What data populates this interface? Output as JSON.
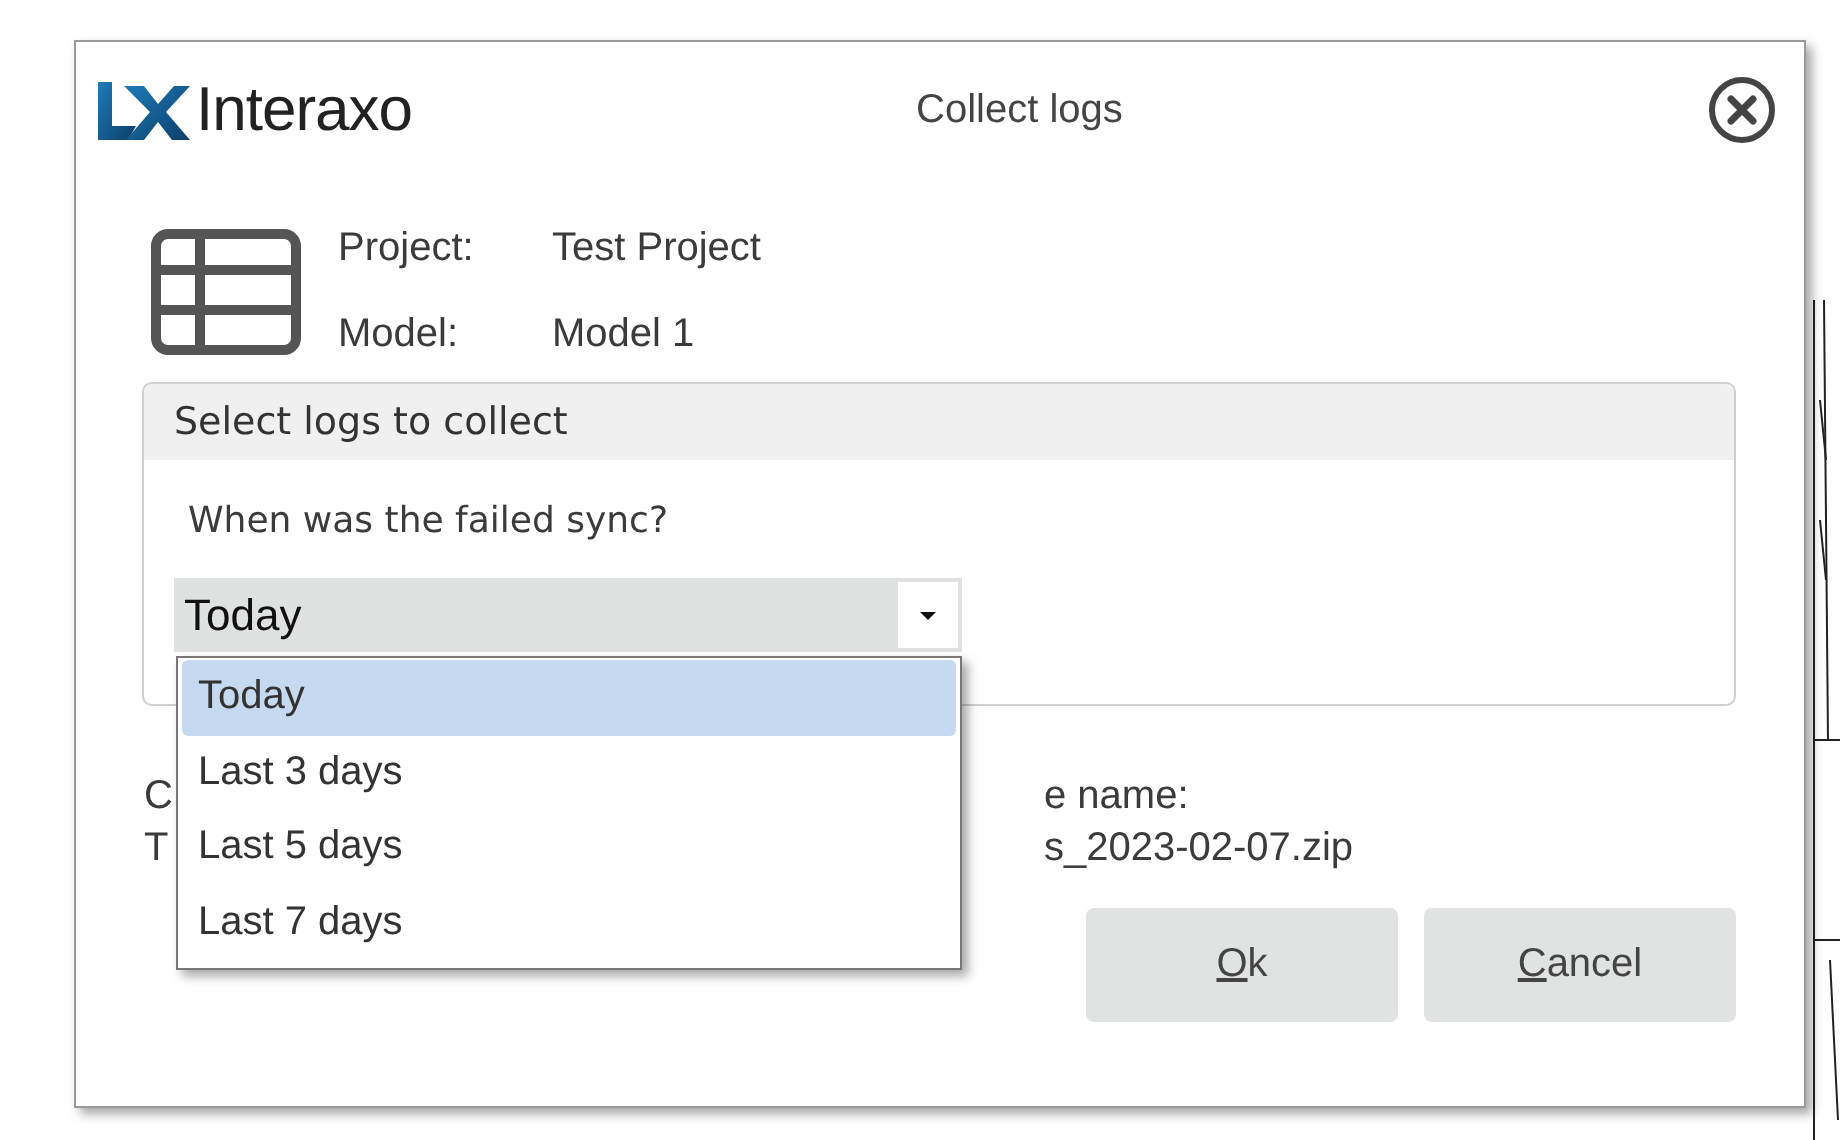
{
  "logo": {
    "text": "Interaxo"
  },
  "title": "Collect logs",
  "info": [
    {
      "label": "Project:",
      "value": "Test Project"
    },
    {
      "label": "Model:",
      "value": "Model 1"
    }
  ],
  "group": {
    "title": "Select logs to collect",
    "question": "When was the failed sync?",
    "select": {
      "value": "Today",
      "expanded": true,
      "options": [
        {
          "label": "Today",
          "selected": true
        },
        {
          "label": "Last 3 days",
          "selected": false
        },
        {
          "label": "Last 5 days",
          "selected": false
        },
        {
          "label": "Last 7 days",
          "selected": false
        }
      ]
    }
  },
  "output": {
    "left": [
      "C",
      "T"
    ],
    "right": [
      "e name:",
      "s_2023-02-07.zip"
    ]
  },
  "buttons": [
    {
      "label": "Ok",
      "underline_first": true
    },
    {
      "label": "Cancel",
      "underline_first": true
    }
  ]
}
